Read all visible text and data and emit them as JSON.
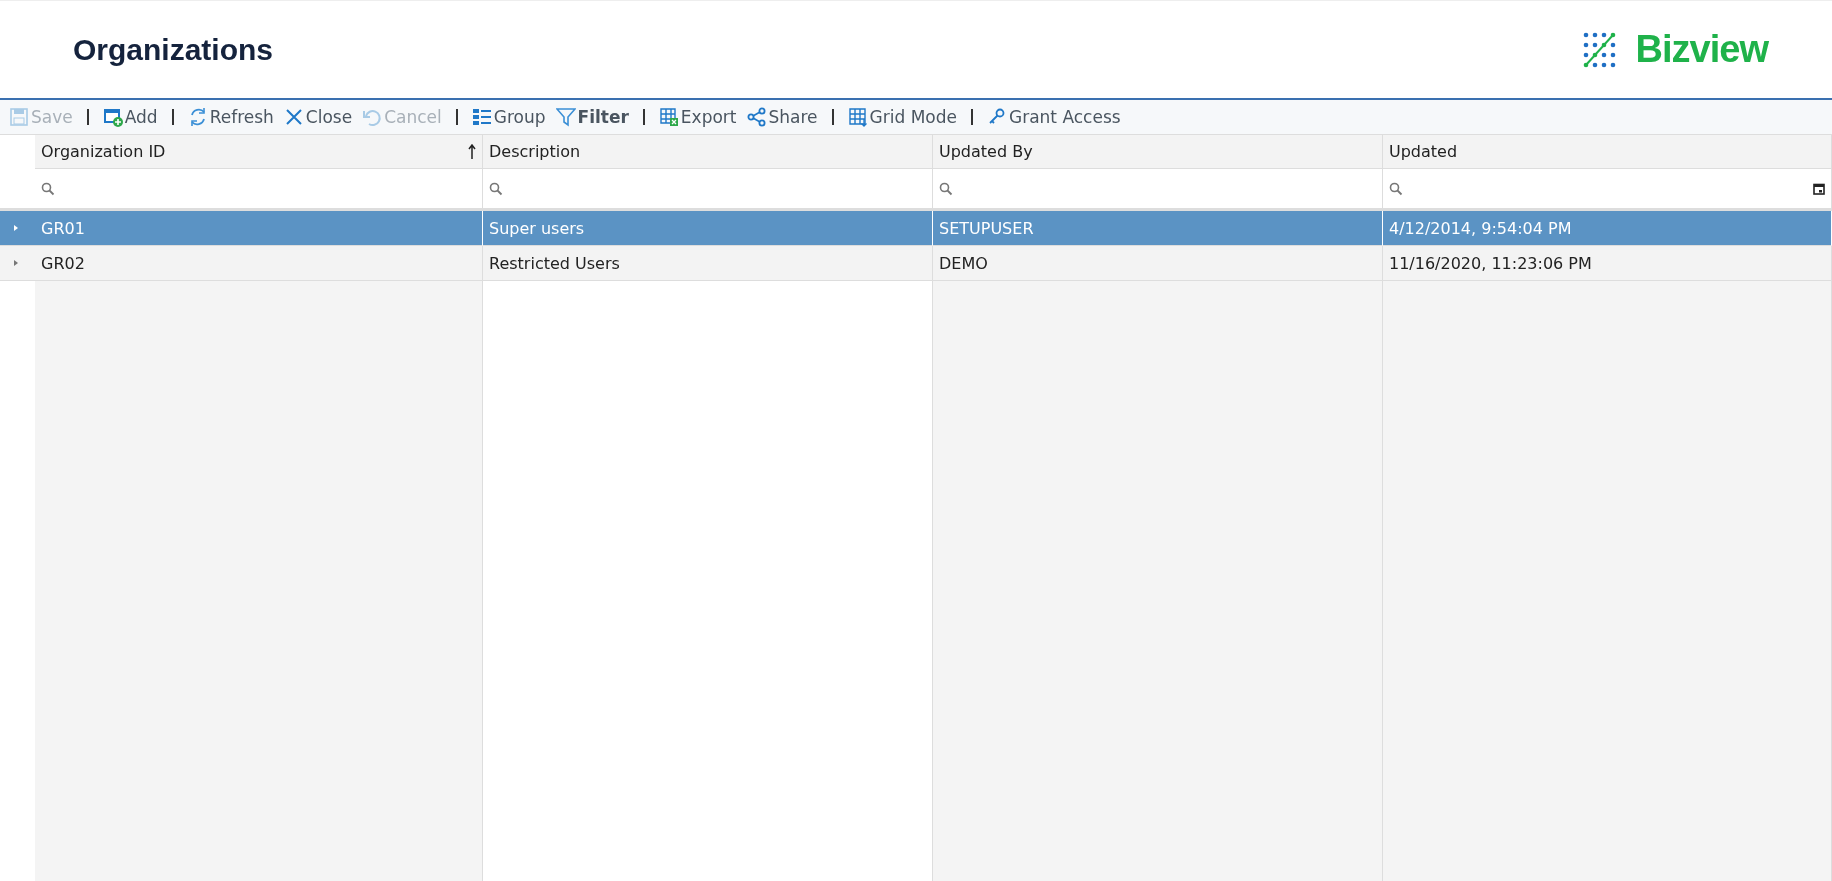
{
  "header": {
    "title": "Organizations",
    "logo": "Bizview"
  },
  "toolbar": [
    {
      "kind": "button",
      "label": "Save",
      "disabled": true,
      "active": false
    },
    {
      "kind": "separator"
    },
    {
      "kind": "button",
      "label": "Add",
      "disabled": false,
      "active": false
    },
    {
      "kind": "separator"
    },
    {
      "kind": "button",
      "label": "Refresh",
      "disabled": false,
      "active": false
    },
    {
      "kind": "button",
      "label": "Close",
      "disabled": false,
      "active": false
    },
    {
      "kind": "button",
      "label": "Cancel",
      "disabled": true,
      "active": false
    },
    {
      "kind": "separator"
    },
    {
      "kind": "button",
      "label": "Group",
      "disabled": false,
      "active": false
    },
    {
      "kind": "button",
      "label": "Filter",
      "disabled": false,
      "active": true
    },
    {
      "kind": "separator"
    },
    {
      "kind": "button",
      "label": "Export",
      "disabled": false,
      "active": false
    },
    {
      "kind": "button",
      "label": "Share",
      "disabled": false,
      "active": false
    },
    {
      "kind": "separator"
    },
    {
      "kind": "button",
      "label": "Grid Mode",
      "disabled": false,
      "active": false
    },
    {
      "kind": "separator"
    },
    {
      "kind": "button",
      "label": "Grant Access",
      "disabled": false,
      "active": false
    }
  ],
  "table": {
    "columns": [
      {
        "label": "Organization ID",
        "sorted": true,
        "kind": "text"
      },
      {
        "label": "Description",
        "sorted": false,
        "kind": "text"
      },
      {
        "label": "Updated By",
        "sorted": false,
        "kind": "text"
      },
      {
        "label": "Updated",
        "sorted": false,
        "kind": "date"
      }
    ],
    "rows": [
      {
        "selected": true,
        "cells": [
          "GR01",
          "Super users",
          "SETUPUSER",
          "4/12/2014, 9:54:04 PM"
        ]
      },
      {
        "selected": false,
        "cells": [
          "GR02",
          "Restricted Users",
          "DEMO",
          "11/16/2020, 11:23:06 PM"
        ]
      }
    ]
  }
}
